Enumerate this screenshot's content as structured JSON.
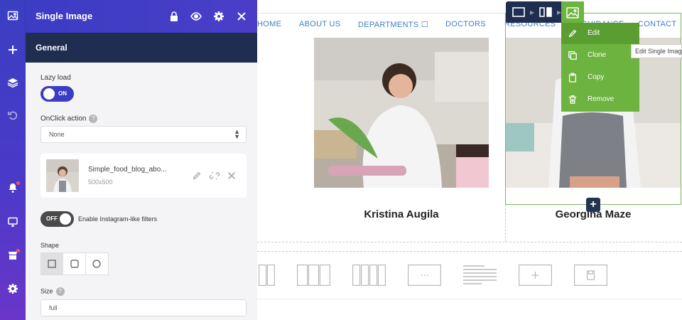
{
  "panel": {
    "title": "Single Image",
    "tab": "General",
    "lazy_load": {
      "label": "Lazy load",
      "state": "ON"
    },
    "onclick": {
      "label": "OnClick action",
      "value": "None"
    },
    "image": {
      "name": "Simple_food_blog_abo...",
      "size": "500x500"
    },
    "instagram": {
      "state": "OFF",
      "label": "Enable Instagram-like filters"
    },
    "shape": {
      "label": "Shape"
    },
    "size": {
      "label": "Size",
      "value": "full"
    }
  },
  "nav": {
    "items": [
      "HOME",
      "ABOUT US",
      "DEPARTMENTS ☐",
      "DOCTORS",
      "RESOURCES",
      "GUIDANCE",
      "CONTACT"
    ]
  },
  "people": [
    {
      "name": "Kristina Augila"
    },
    {
      "name": "Georgina Maze"
    }
  ],
  "context_menu": {
    "items": [
      "Edit",
      "Clone",
      "Copy",
      "Remove"
    ],
    "tooltip": "Edit Single Image"
  },
  "colors": {
    "accent": "#3c3cc4",
    "dark_navy": "#1e2d50",
    "green": "#6db33f",
    "link_blue": "#3d7fc1"
  }
}
